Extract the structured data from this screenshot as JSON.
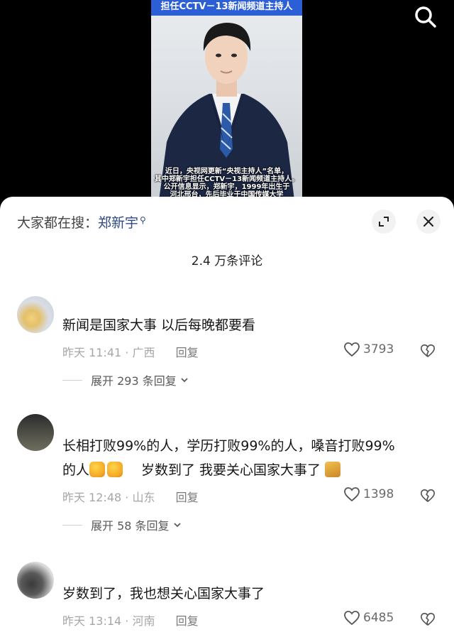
{
  "video": {
    "title_banner": "担任CCTV－13新闻频道主持人",
    "caption": "近日，央视网更新“央视主持人”名单，\n其中郑新宇担任CCTV－13新闻频道主持人。\n公开信息显示，郑新宇，1999年出生于\n河北邢台，先后毕业于中国传媒大学"
  },
  "search_bar": {
    "prefix": "大家都在搜：",
    "keyword": "郑新宇"
  },
  "comments_header": {
    "count_text": "2.4 万条评论"
  },
  "comments": [
    {
      "text": "新闻是国家大事 以后每晚都要看",
      "time": "昨天 11:41",
      "location": "广西",
      "reply": "回复",
      "likes": "3793",
      "expand": "展开 293 条回复"
    },
    {
      "text_line1": "长相打败99%的人，学历打败99%的人，嗓音打败99%",
      "text_line2_a": "的人",
      "text_line2_b": "岁数到了  我要关心国家大事了",
      "emojis": [
        "thumbs-up-emoji",
        "thumbs-up-emoji",
        "cat-emoji"
      ],
      "time": "昨天 12:48",
      "location": "山东",
      "reply": "回复",
      "likes": "1398",
      "expand": "展开 58 条回复"
    },
    {
      "text": "岁数到了，我也想关心国家大事了",
      "time": "昨天 13:14",
      "location": "河南",
      "reply": "回复",
      "likes": "6485"
    }
  ],
  "icons": {
    "search": "search-icon",
    "expand": "expand-icon",
    "close": "close-icon",
    "like": "heart-icon",
    "dislike": "broken-heart-icon",
    "chevron": "chevron-down-icon"
  },
  "colors": {
    "keyword": "#2f4a84",
    "banner": "#2c5fd6",
    "meta": "#a6a6a6"
  }
}
